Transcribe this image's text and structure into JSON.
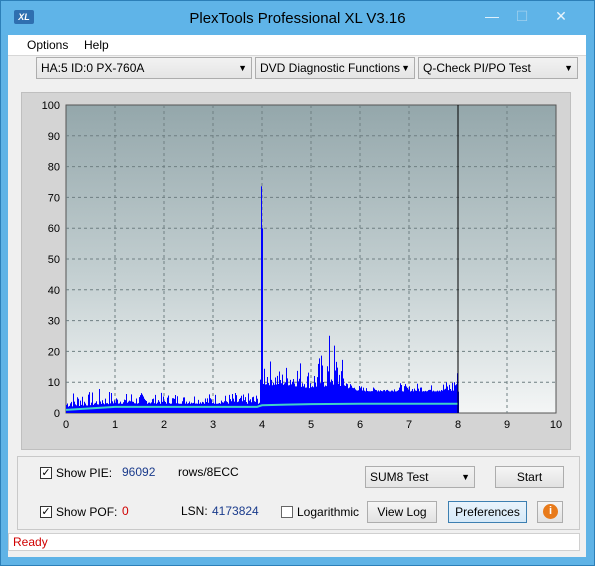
{
  "window": {
    "title": "PlexTools Professional XL V3.16",
    "icon_text": "XL",
    "minimize": "—",
    "maximize": "☐",
    "close": "✕"
  },
  "menu": {
    "options": "Options",
    "help": "Help"
  },
  "selectors": {
    "drive": "HA:5 ID:0  PX-760A",
    "function": "DVD Diagnostic Functions",
    "test": "Q-Check PI/PO Test"
  },
  "chart_data": {
    "type": "bar",
    "xlim": [
      0,
      10
    ],
    "ylim": [
      0,
      100
    ],
    "x_ticks": [
      "0",
      "1",
      "2",
      "3",
      "4",
      "5",
      "6",
      "7",
      "8",
      "9",
      "10"
    ],
    "y_ticks": [
      "0",
      "10",
      "20",
      "30",
      "40",
      "50",
      "60",
      "70",
      "80",
      "90",
      "100"
    ],
    "grid": true,
    "test_end_x": 8.0,
    "marker_x": 8.0,
    "pie_envelope": [
      [
        0.0,
        5
      ],
      [
        0.1,
        9
      ],
      [
        0.2,
        6
      ],
      [
        0.3,
        11
      ],
      [
        0.4,
        5
      ],
      [
        0.5,
        8
      ],
      [
        0.6,
        5
      ],
      [
        0.7,
        9
      ],
      [
        0.8,
        6
      ],
      [
        0.9,
        8
      ],
      [
        1.0,
        6
      ],
      [
        1.1,
        7
      ],
      [
        1.2,
        6
      ],
      [
        1.3,
        8
      ],
      [
        1.4,
        6
      ],
      [
        1.5,
        7
      ],
      [
        1.6,
        6
      ],
      [
        1.7,
        7
      ],
      [
        1.8,
        6
      ],
      [
        1.9,
        7
      ],
      [
        2.0,
        6
      ],
      [
        2.2,
        7
      ],
      [
        2.4,
        6
      ],
      [
        2.6,
        7
      ],
      [
        2.8,
        6
      ],
      [
        3.0,
        7
      ],
      [
        3.2,
        6
      ],
      [
        3.4,
        7
      ],
      [
        3.6,
        6
      ],
      [
        3.8,
        7
      ],
      [
        3.95,
        6
      ],
      [
        3.97,
        80
      ],
      [
        4.0,
        60
      ],
      [
        4.03,
        22
      ],
      [
        4.1,
        20
      ],
      [
        4.2,
        16
      ],
      [
        4.4,
        14
      ],
      [
        4.6,
        19
      ],
      [
        4.8,
        18
      ],
      [
        5.0,
        14
      ],
      [
        5.1,
        17
      ],
      [
        5.2,
        20
      ],
      [
        5.3,
        19
      ],
      [
        5.4,
        30
      ],
      [
        5.5,
        22
      ],
      [
        5.6,
        20
      ],
      [
        5.7,
        14
      ],
      [
        5.8,
        10
      ],
      [
        6.0,
        9
      ],
      [
        6.2,
        8
      ],
      [
        6.4,
        9
      ],
      [
        6.6,
        8
      ],
      [
        6.8,
        10
      ],
      [
        7.0,
        9
      ],
      [
        7.2,
        10
      ],
      [
        7.4,
        9
      ],
      [
        7.6,
        10
      ],
      [
        7.8,
        11
      ],
      [
        7.9,
        12
      ],
      [
        7.95,
        22
      ],
      [
        7.98,
        15
      ],
      [
        8.0,
        0
      ]
    ],
    "pie_base": [
      [
        0.0,
        2
      ],
      [
        1.0,
        3
      ],
      [
        2.0,
        3
      ],
      [
        3.0,
        3
      ],
      [
        3.95,
        3
      ],
      [
        4.0,
        9
      ],
      [
        4.5,
        9
      ],
      [
        5.0,
        8
      ],
      [
        5.5,
        9
      ],
      [
        6.0,
        7
      ],
      [
        7.0,
        7
      ],
      [
        8.0,
        7
      ]
    ],
    "total_line": [
      [
        0.0,
        1
      ],
      [
        0.5,
        1.5
      ],
      [
        1.0,
        2
      ],
      [
        2.0,
        2
      ],
      [
        3.0,
        2
      ],
      [
        3.9,
        2
      ],
      [
        4.0,
        2.5
      ],
      [
        4.5,
        2.7
      ],
      [
        5.0,
        2.9
      ],
      [
        6.0,
        3
      ],
      [
        7.0,
        3
      ],
      [
        8.0,
        3
      ]
    ]
  },
  "controls": {
    "show_pie": "Show PIE:",
    "pie_value": "96092",
    "pie_unit": "rows/8ECC",
    "show_pof": "Show POF:",
    "pof_value": "0",
    "lsn_label": "LSN:",
    "lsn_value": "4173824",
    "logarithmic": "Logarithmic",
    "sum_select": "SUM8 Test",
    "start": "Start",
    "view_log": "View Log",
    "preferences": "Preferences",
    "check_mark": "✓"
  },
  "status": {
    "text": "Ready"
  },
  "colors": {
    "bar": "#0000ff",
    "total_line": "#3fd0c8",
    "plot_bg": "#9aabaf",
    "plot_bg_bottom": "#f2f4f4",
    "status_text": "#d00000"
  }
}
